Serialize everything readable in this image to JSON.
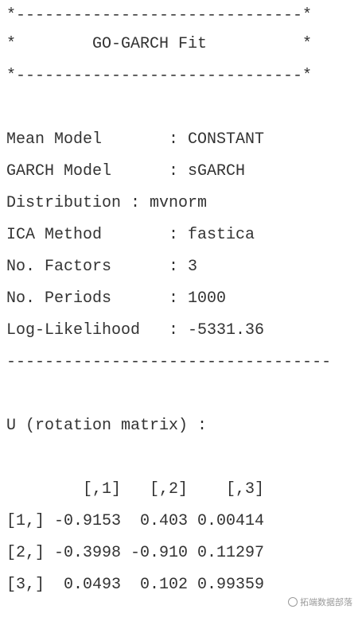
{
  "console": {
    "lines": [
      "*------------------------------*",
      "*        GO-GARCH Fit          *",
      "*------------------------------*",
      "",
      "Mean Model       : CONSTANT",
      "GARCH Model      : sGARCH",
      "Distribution : mvnorm",
      "ICA Method       : fastica",
      "No. Factors      : 3",
      "No. Periods      : 1000",
      "Log-Likelihood   : -5331.36",
      "----------------------------------",
      "",
      "U (rotation matrix) :",
      "",
      "        [,1]   [,2]    [,3]",
      "[1,] -0.9153  0.403 0.00414",
      "[2,] -0.3998 -0.910 0.11297",
      "[3,]  0.0493  0.102 0.99359"
    ]
  },
  "watermark": {
    "text": "拓端数据部落"
  }
}
